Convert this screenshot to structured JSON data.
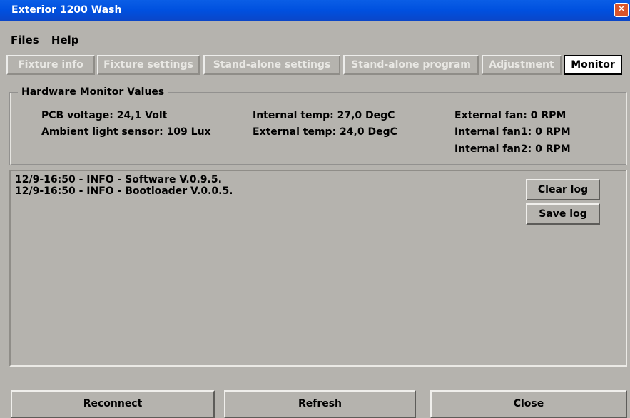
{
  "window": {
    "title": "Exterior 1200 Wash"
  },
  "menu": {
    "items": [
      "Files",
      "Help"
    ]
  },
  "tabs": [
    {
      "label": "Fixture info"
    },
    {
      "label": "Fixture settings"
    },
    {
      "label": "Stand-alone settings"
    },
    {
      "label": "Stand-alone program"
    },
    {
      "label": "Adjustment"
    },
    {
      "label": "Monitor"
    }
  ],
  "hardware": {
    "legend": "Hardware Monitor Values",
    "pcb_voltage": "PCB voltage: 24,1 Volt",
    "ambient_light": "Ambient light sensor: 109 Lux",
    "internal_temp": "Internal temp: 27,0 DegC",
    "external_temp": "External temp: 24,0 DegC",
    "external_fan": "External fan: 0 RPM",
    "internal_fan1": "Internal fan1: 0 RPM",
    "internal_fan2": "Internal fan2: 0 RPM"
  },
  "log": {
    "lines": [
      "12/9-16:50 - INFO - Software V.0.9.5.",
      "12/9-16:50 - INFO - Bootloader V.0.0.5."
    ],
    "clear_label": "Clear log",
    "save_label": "Save log"
  },
  "footer": {
    "reconnect_label": "Reconnect",
    "refresh_label": "Refresh",
    "close_label": "Close"
  }
}
